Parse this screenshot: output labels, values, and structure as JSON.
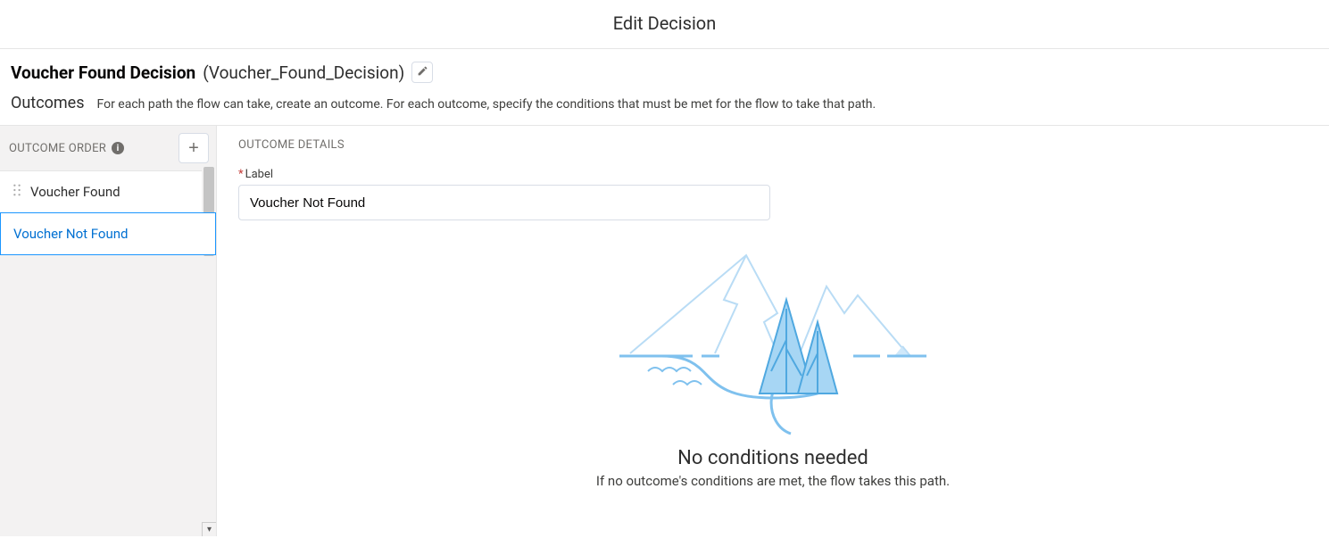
{
  "header": {
    "title": "Edit Decision"
  },
  "decision": {
    "label": "Voucher Found Decision",
    "api_name": "(Voucher_Found_Decision)"
  },
  "outcomes_section": {
    "title": "Outcomes",
    "help": "For each path the flow can take, create an outcome. For each outcome, specify the conditions that must be met for the flow to take that path."
  },
  "sidebar": {
    "order_label": "OUTCOME ORDER",
    "items": [
      {
        "label": "Voucher Found",
        "selected": false,
        "draggable": true
      },
      {
        "label": "Voucher Not Found",
        "selected": true,
        "draggable": false
      }
    ]
  },
  "details": {
    "heading": "OUTCOME DETAILS",
    "label_field_label": "Label",
    "label_value": "Voucher Not Found",
    "empty_title": "No conditions needed",
    "empty_sub": "If no outcome's conditions are met, the flow takes this path."
  }
}
